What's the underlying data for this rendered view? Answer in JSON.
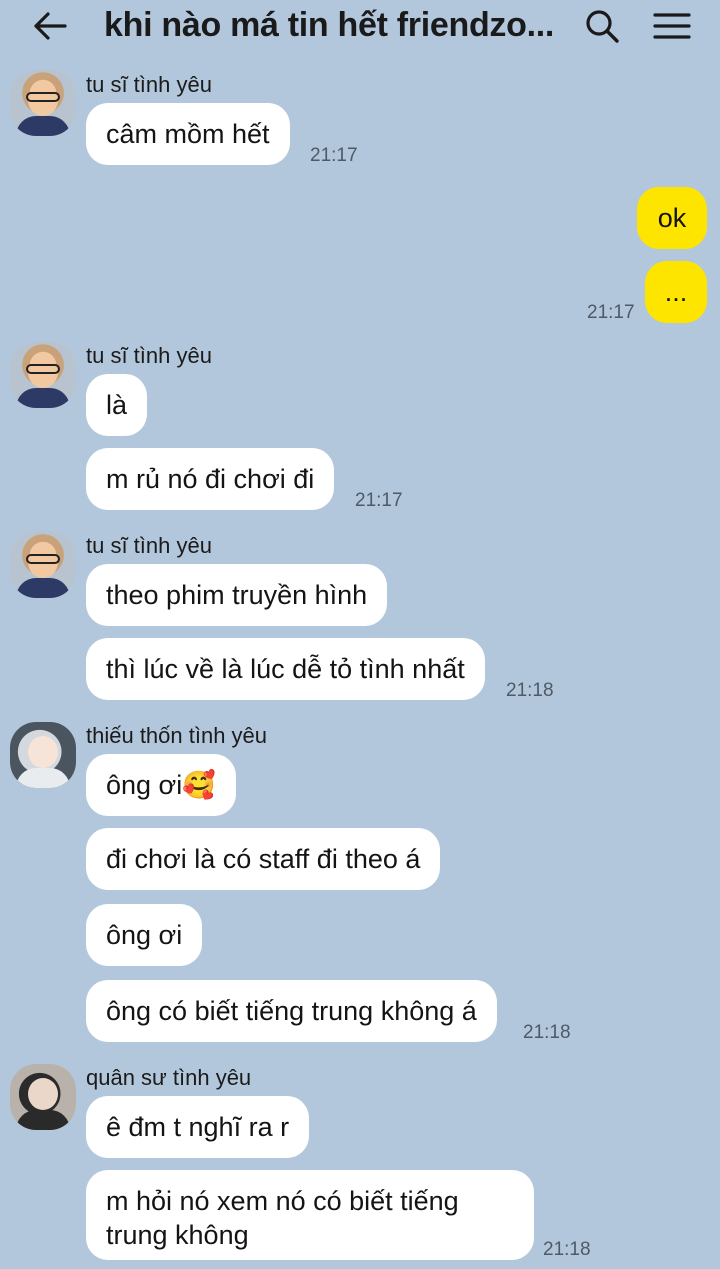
{
  "header": {
    "title": "khi nào má tin hết friendzo..."
  },
  "messages": [
    {
      "sender": "tu sĩ tình yêu",
      "texts": [
        "câm mồm hết"
      ],
      "time": "21:17"
    },
    {
      "sender": "me",
      "texts": [
        "ok",
        "..."
      ],
      "time": "21:17"
    },
    {
      "sender": "tu sĩ tình yêu",
      "texts": [
        "là",
        "m rủ nó đi chơi đi"
      ],
      "time": "21:17"
    },
    {
      "sender": "tu sĩ tình yêu",
      "texts": [
        "theo phim truyền hình",
        "thì lúc về là lúc dễ tỏ tình nhất"
      ],
      "time": "21:18"
    },
    {
      "sender": "thiếu thốn tình yêu",
      "texts": [
        "ông ơi🥰",
        "đi chơi là có staff đi theo á",
        "ông ơi",
        "ông có biết tiếng trung không á"
      ],
      "time": "21:18"
    },
    {
      "sender": "quân sư tình yêu",
      "texts": [
        "ê đm t nghĩ ra r",
        "m hỏi nó xem nó có biết tiếng trung không"
      ],
      "time": "21:18"
    }
  ]
}
